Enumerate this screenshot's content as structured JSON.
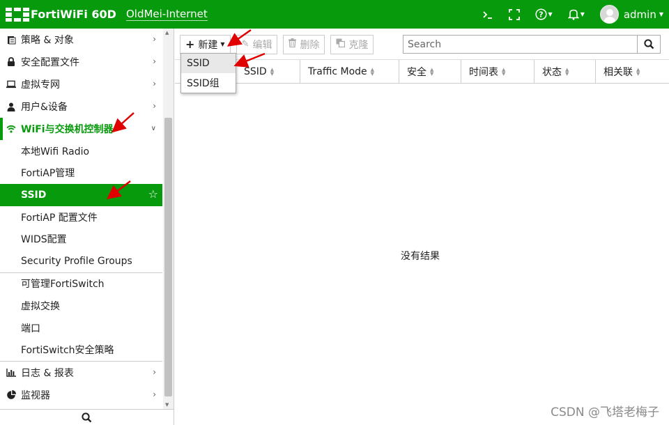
{
  "header": {
    "product_name": "FortiWiFi 60D",
    "hostname": "OldMei-Internet",
    "username": "admin",
    "icons": [
      "cli-console-icon",
      "fullscreen-icon",
      "help-icon",
      "notification-bell-icon",
      "user-avatar-icon"
    ],
    "brand_color": "#079a0c"
  },
  "sidebar": {
    "items_top": [
      {
        "label": "策略 & 对象",
        "icon": "policy-icon"
      },
      {
        "label": "安全配置文件",
        "icon": "lock-icon"
      },
      {
        "label": "虚拟专网",
        "icon": "laptop-icon"
      },
      {
        "label": "用户&设备",
        "icon": "user-icon"
      }
    ],
    "open_section": {
      "label": "WiFi与交换机控制器",
      "icon": "wifi-icon"
    },
    "sub_items_wifi": [
      {
        "label": "本地Wifi Radio"
      },
      {
        "label": "FortiAP管理"
      },
      {
        "label": "SSID",
        "active": true
      },
      {
        "label": "FortiAP 配置文件"
      },
      {
        "label": "WIDS配置"
      },
      {
        "label": "Security Profile Groups"
      }
    ],
    "sub_items_switch": [
      {
        "label": "可管理FortiSwitch"
      },
      {
        "label": "虚拟交换"
      },
      {
        "label": "端口"
      },
      {
        "label": "FortiSwitch安全策略"
      }
    ],
    "items_bottom": [
      {
        "label": "日志 & 报表",
        "icon": "bar-chart-icon"
      },
      {
        "label": "监视器",
        "icon": "pie-chart-icon"
      }
    ]
  },
  "toolbar": {
    "new_label": "新建",
    "edit_label": "编辑",
    "delete_label": "删除",
    "clone_label": "克隆",
    "search_placeholder": "Search"
  },
  "dropdown": {
    "items": [
      "SSID",
      "SSID组"
    ]
  },
  "table": {
    "columns": [
      "SSID",
      "Traffic Mode",
      "安全",
      "时间表",
      "状态",
      "相关联"
    ],
    "empty_message": "没有结果"
  },
  "watermark": "CSDN @飞塔老梅子",
  "annotation_color": "#e00000"
}
